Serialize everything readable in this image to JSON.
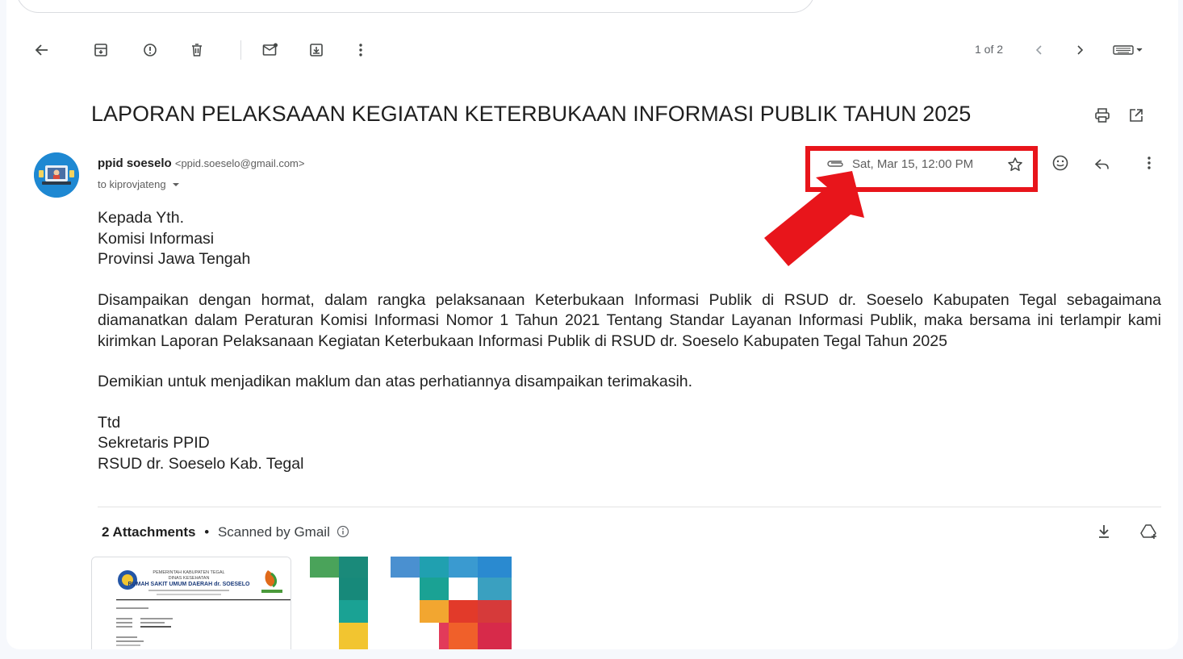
{
  "toolbar": {
    "icons": [
      "back-arrow-icon",
      "archive-icon",
      "report-spam-icon",
      "delete-icon",
      "mark-unread-icon",
      "move-to-icon",
      "more-vertical-icon"
    ],
    "pager": "1 of 2"
  },
  "message": {
    "subject": "LAPORAN PELAKSAAAN KEGIATAN KETERBUKAAN INFORMASI PUBLIK TAHUN 2025",
    "sender_name": "ppid soeselo",
    "sender_email": "<ppid.soeselo@gmail.com>",
    "to_line": "to kiprovjateng",
    "date": "Sat, Mar 15, 12:00 PM",
    "body": {
      "greeting": [
        "Kepada Yth.",
        "Komisi Informasi",
        "Provinsi Jawa Tengah"
      ],
      "paragraph1": "Disampaikan dengan hormat, dalam rangka pelaksanaan Keterbukaan Informasi Publik di RSUD dr. Soeselo Kabupaten Tegal sebagaimana diamanatkan dalam Peraturan Komisi Informasi Nomor 1 Tahun 2021 Tentang Standar Layanan Informasi Publik, maka bersama ini terlampir kami kirimkan Laporan Pelaksanaan Kegiatan Keterbukaan Informasi Publik di RSUD dr. Soeselo Kabupaten Tegal Tahun 2025",
      "paragraph2": "Demikian untuk menjadikan maklum dan atas perhatiannya disampaikan terimakasih.",
      "signature": [
        "Ttd",
        "Sekretaris PPID",
        "RSUD dr. Soeselo Kab. Tegal"
      ]
    }
  },
  "attachments": {
    "count_label": "2 Attachments",
    "separator": "•",
    "scanned_label": "Scanned by Gmail",
    "doc_header": [
      "PEMERINTAH KABUPATEN TEGAL",
      "DINAS KESEHATAN",
      "RUMAH SAKIT UMUM DAERAH dr. SOESELO"
    ]
  },
  "colors": {
    "highlight": "#e8151b",
    "text": "#202124",
    "muted": "#5e5e5e"
  }
}
